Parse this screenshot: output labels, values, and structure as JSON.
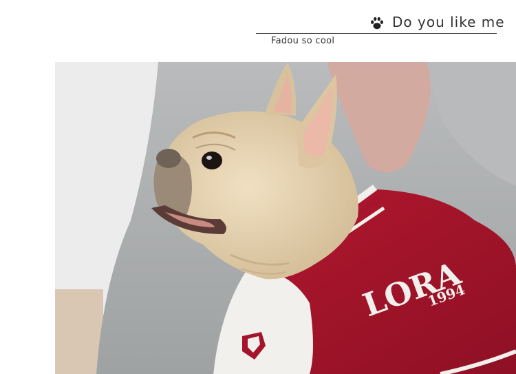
{
  "header": {
    "title": "Do you like me",
    "subtitle": "Fadou so cool",
    "icon": "paw-icon"
  },
  "photo": {
    "jacket_lettering": "LORA",
    "jacket_sub_lettering": "1994"
  },
  "colors": {
    "text": "#333333",
    "jacket_red": "#a4142c",
    "jacket_white": "#f2f0ec",
    "dog_fawn": "#e8d6b4",
    "sofa_grey": "#a9abac"
  }
}
